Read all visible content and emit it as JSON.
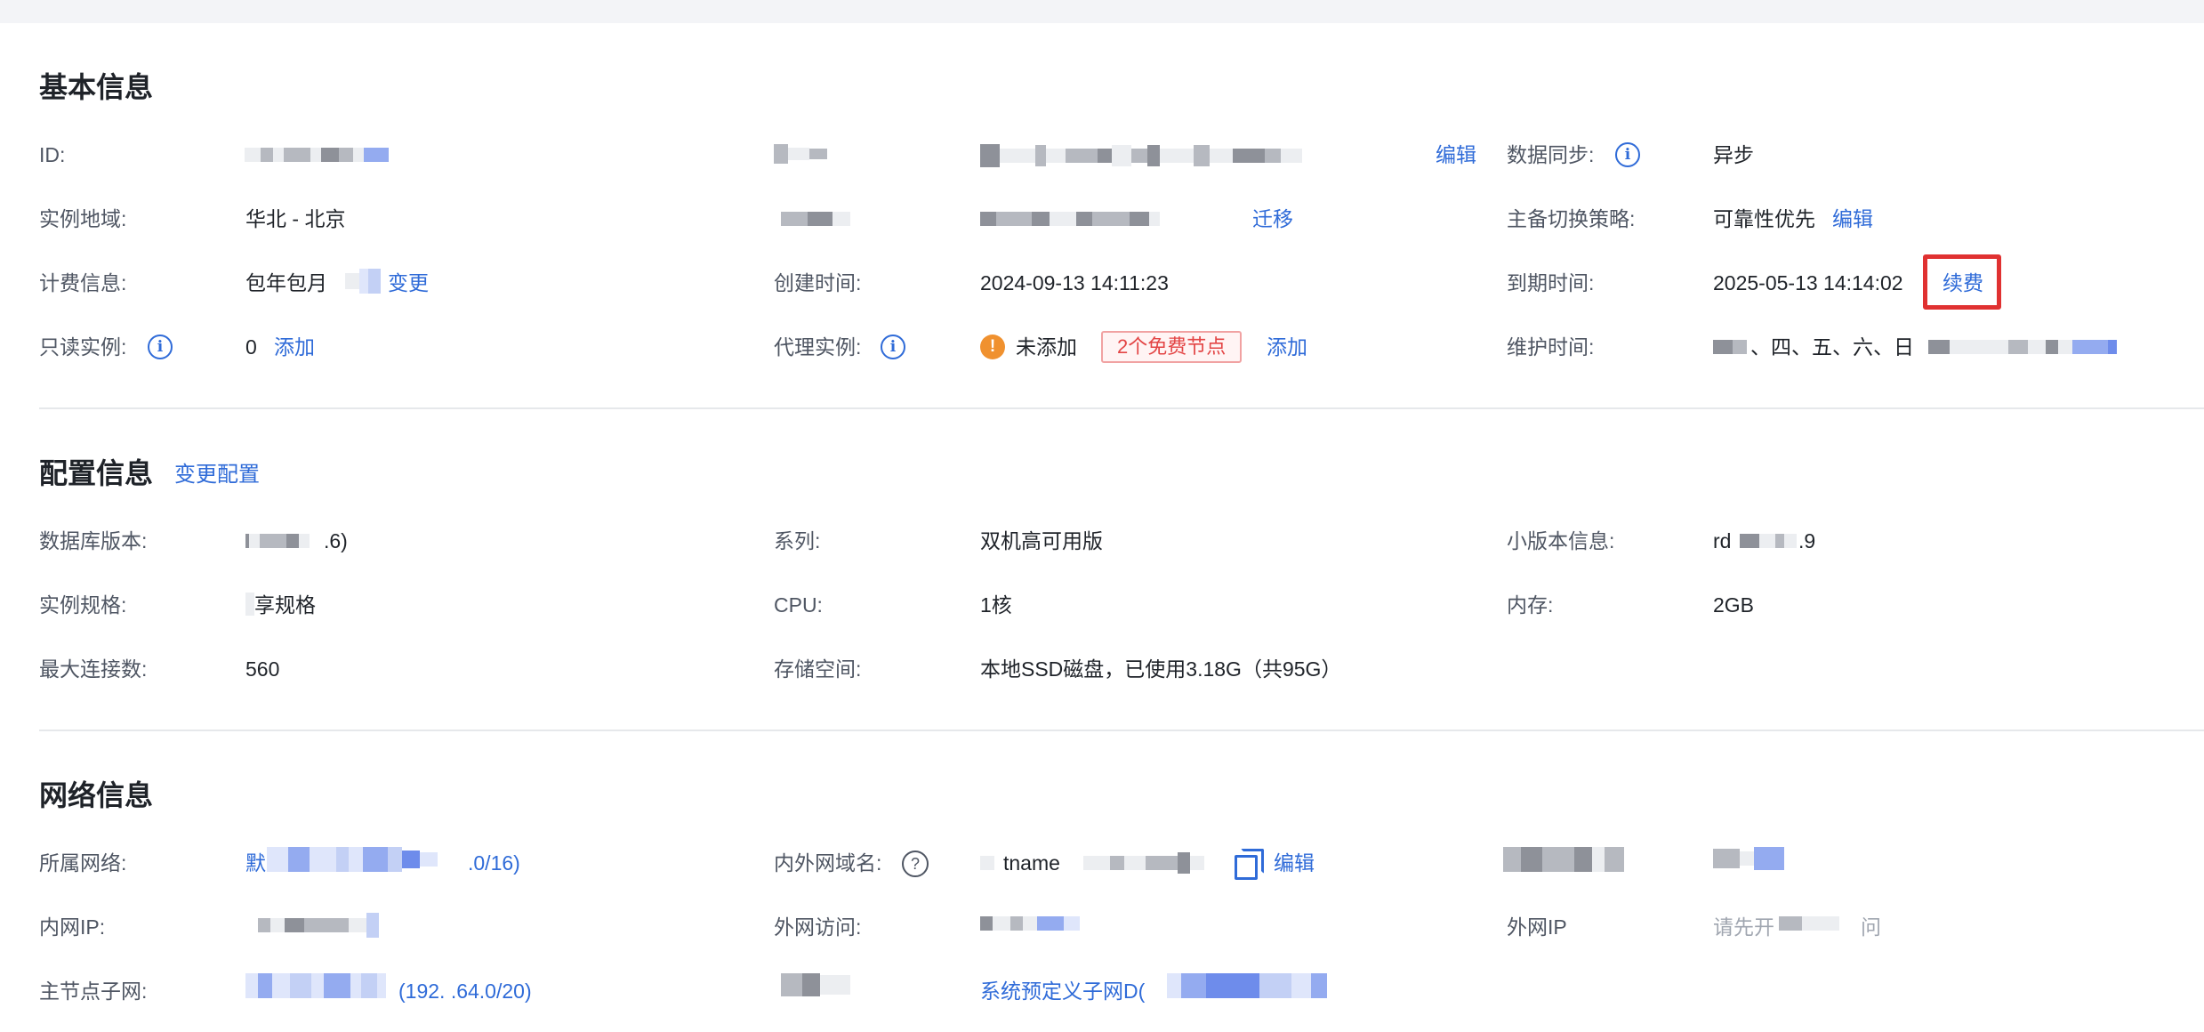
{
  "basic": {
    "title": "基本信息",
    "id_label": "ID:",
    "region_label": "实例地域:",
    "region_value": "华北 - 北京",
    "billing_label": "计费信息:",
    "billing_value": "包年包月",
    "billing_change": "变更",
    "readonly_label": "只读实例:",
    "readonly_value": "0",
    "readonly_add": "添加",
    "name_edit": "编辑",
    "migrate_link": "迁移",
    "created_label": "创建时间:",
    "created_value": "2024-09-13 14:11:23",
    "proxy_label": "代理实例:",
    "proxy_value": "未添加",
    "proxy_tag": "2个免费节点",
    "proxy_add": "添加",
    "sync_label": "数据同步:",
    "sync_value": "异步",
    "switch_label": "主备切换策略:",
    "switch_value": "可靠性优先",
    "switch_edit": "编辑",
    "expire_label": "到期时间:",
    "expire_value": "2025-05-13 14:14:02",
    "renew_link": "续费",
    "maintain_label": "维护时间:",
    "maintain_value": "、四、五、六、日"
  },
  "config": {
    "title": "配置信息",
    "change_link": "变更配置",
    "db_version_label": "数据库版本:",
    "db_version_value": ".6)",
    "spec_label": "实例规格:",
    "spec_value": "享规格",
    "maxconn_label": "最大连接数:",
    "maxconn_value": "560",
    "series_label": "系列:",
    "series_value": "双机高可用版",
    "cpu_label": "CPU:",
    "cpu_value": "1核",
    "storage_label": "存储空间:",
    "storage_value": "本地SSD磁盘，已使用3.18G（共95G）",
    "minor_label": "小版本信息:",
    "minor_value_a": "rd",
    "minor_value_b": ".9",
    "memory_label": "内存:",
    "memory_value": "2GB"
  },
  "network": {
    "title": "网络信息",
    "vpc_label": "所属网络:",
    "vpc_value_a": "默",
    "vpc_value_b": ".0/16)",
    "private_ip_label": "内网IP:",
    "subnet_label": "主节点子网:",
    "subnet_value": "(192.   .64.0/20)",
    "domain_label": "内外网域名:",
    "domain_value": "tname",
    "domain_edit": "编辑",
    "public_access_label": "外网访问:",
    "standby_subnet_value": "系统预定义子网D(",
    "public_ip_label": "外网IP",
    "public_ip_value": "请先开",
    "public_ip_tail": "问"
  }
}
